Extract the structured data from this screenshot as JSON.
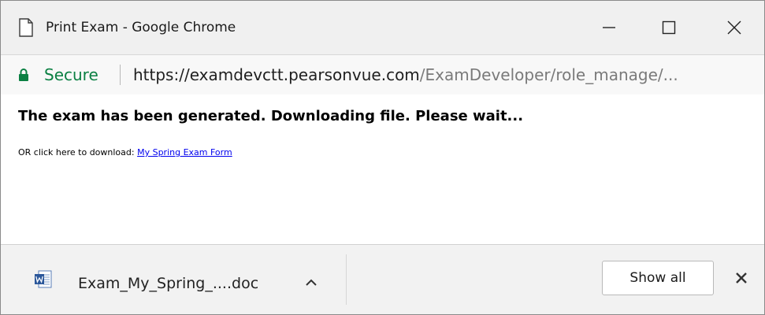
{
  "window": {
    "title": "Print Exam - Google Chrome",
    "controls": {
      "minimize": "minimize-icon",
      "maximize": "maximize-icon",
      "close": "close-icon"
    }
  },
  "address_bar": {
    "secure_label": "Secure",
    "url_host": "https://examdevctt.pearsonvue.com",
    "url_path": "/ExamDeveloper/role_manage/...",
    "secure_color": "#0b8043"
  },
  "content": {
    "heading": "The exam has been generated. Downloading file. Please wait...",
    "download_prompt": "OR click here to download:",
    "download_link": "My Spring Exam Form",
    "link_color": "#0000ee"
  },
  "download_bar": {
    "filename": "Exam_My_Spring_....doc",
    "file_icon": "word-document-icon",
    "show_all_label": "Show all"
  }
}
